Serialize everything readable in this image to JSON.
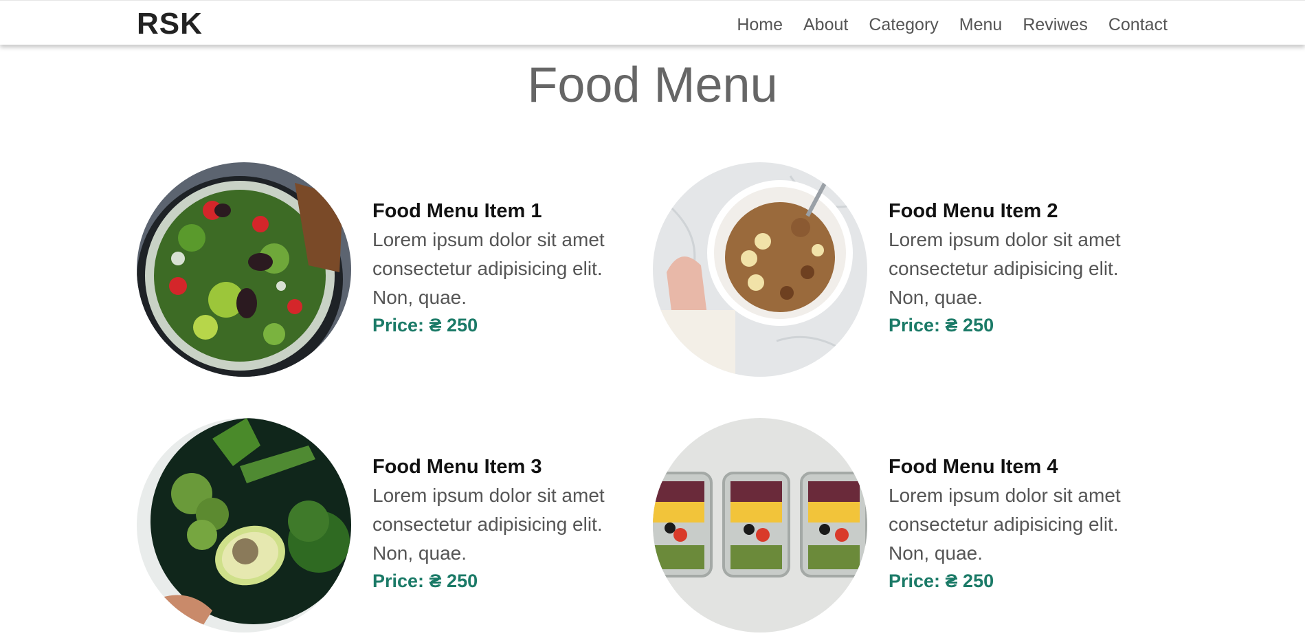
{
  "brand": {
    "logo": "RSK"
  },
  "nav": [
    "Home",
    "About",
    "Category",
    "Menu",
    "Reviwes",
    "Contact"
  ],
  "page": {
    "title": "Food Menu"
  },
  "menu_items": [
    {
      "name": "Food Menu Item 1",
      "description": "Lorem ipsum dolor sit amet consectetur adipisicing elit. Non, quae.",
      "price": "Price: ₴ 250",
      "image_icon": "salad-bowl-image"
    },
    {
      "name": "Food Menu Item 2",
      "description": "Lorem ipsum dolor sit amet consectetur adipisicing elit. Non, quae.",
      "price": "Price: ₴ 250",
      "image_icon": "granola-bowl-image"
    },
    {
      "name": "Food Menu Item 3",
      "description": "Lorem ipsum dolor sit amet consectetur adipisicing elit. Non, quae.",
      "price": "Price: ₴ 250",
      "image_icon": "green-vegetables-image"
    },
    {
      "name": "Food Menu Item 4",
      "description": "Lorem ipsum dolor sit amet consectetur adipisicing elit. Non, quae.",
      "price": "Price: ₴ 250",
      "image_icon": "meal-prep-containers-image"
    }
  ],
  "colors": {
    "price": "#1b7a67",
    "title": "#666666",
    "nav_text": "#555555",
    "logo": "#222222"
  }
}
